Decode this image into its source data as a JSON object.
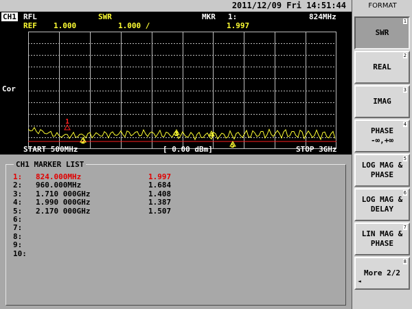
{
  "datetime": "2011/12/09 Fri 14:51:44",
  "trace": {
    "channel": "CH1",
    "meas": "RFL",
    "format": "SWR",
    "marker_label": "MKR",
    "marker_num": "1:",
    "marker_freq": "824MHz",
    "ref_label": "REF",
    "ref_value": "1.000",
    "scale": "1.000 /",
    "marker_value": "1.997",
    "cor": "Cor",
    "start": "START 500MHz",
    "power": "[ 0.00 dBm]",
    "stop": "STOP 3GHz",
    "marker_tags": [
      "1",
      "2",
      "3",
      "4",
      "5"
    ]
  },
  "marker_list": {
    "title": "CH1 MARKER LIST",
    "rows": [
      {
        "idx": "1:",
        "freq": "824.000MHz",
        "value": "1.997"
      },
      {
        "idx": "2:",
        "freq": "960.000MHz",
        "value": "1.684"
      },
      {
        "idx": "3:",
        "freq": "1.710 000GHz",
        "value": "1.408"
      },
      {
        "idx": "4:",
        "freq": "1.990 000GHz",
        "value": "1.387"
      },
      {
        "idx": "5:",
        "freq": "2.170 000GHz",
        "value": "1.507"
      },
      {
        "idx": "6:",
        "freq": "",
        "value": ""
      },
      {
        "idx": "7:",
        "freq": "",
        "value": ""
      },
      {
        "idx": "8:",
        "freq": "",
        "value": ""
      },
      {
        "idx": "9:",
        "freq": "",
        "value": ""
      },
      {
        "idx": "10:",
        "freq": "",
        "value": ""
      }
    ]
  },
  "softkeys": {
    "title": "FORMAT",
    "items": [
      {
        "label": "SWR",
        "num": "1"
      },
      {
        "label": "REAL",
        "num": "2"
      },
      {
        "label": "IMAG",
        "num": "3"
      },
      {
        "label": "PHASE\n-∞,+∞",
        "num": "4"
      },
      {
        "label": "LOG MAG &\nPHASE",
        "num": "5"
      },
      {
        "label": "LOG MAG &\nDELAY",
        "num": "6"
      },
      {
        "label": "LIN MAG &\nPHASE",
        "num": "7"
      },
      {
        "label": "More 2/2",
        "num": "8"
      }
    ],
    "more_arrow": "◄"
  },
  "colors": {
    "trace": "#ffff33",
    "grid": "#bfbfbf",
    "active_marker": "#ff2020"
  }
}
